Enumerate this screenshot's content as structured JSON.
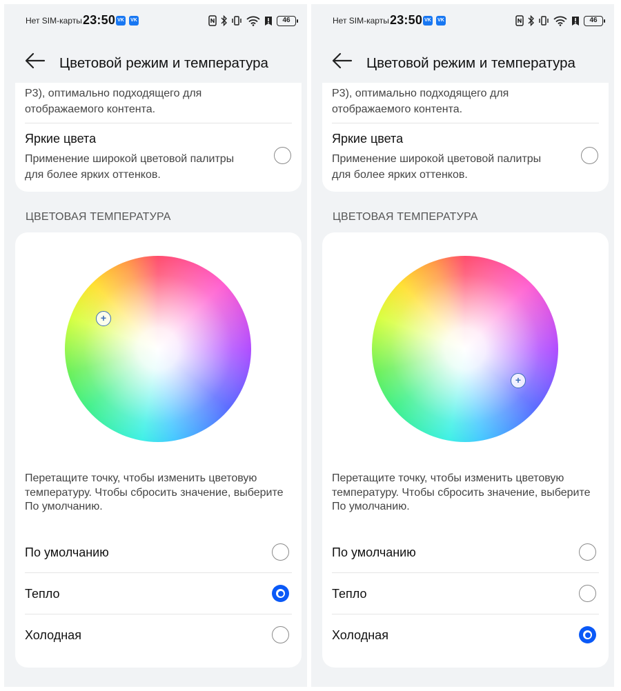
{
  "screens": [
    {
      "status": {
        "carrier": "Нет SIM-карты",
        "time": "23:50",
        "vk": "VK",
        "battery": "46"
      },
      "title": "Цветовой режим и температура",
      "top_card": {
        "partial_text": "P3), оптимально подходящего для отображаемого контента.",
        "vivid_title": "Яркие цвета",
        "vivid_desc": "Применение широкой цветовой палитры для более ярких оттенков."
      },
      "section_title": "ЦВЕТОВАЯ ТЕМПЕРАТУРА",
      "picker_symbol": "+",
      "hint": "Перетащите точку, чтобы изменить цветовую температуру. Чтобы сбросить значение, выберите По умолчанию.",
      "options": [
        {
          "label": "По умолчанию",
          "selected": false
        },
        {
          "label": "Тепло",
          "selected": true
        },
        {
          "label": "Холодная",
          "selected": false
        }
      ]
    },
    {
      "status": {
        "carrier": "Нет SIM-карты",
        "time": "23:50",
        "vk": "VK",
        "battery": "46"
      },
      "title": "Цветовой режим и температура",
      "top_card": {
        "partial_text": "P3), оптимально подходящего для отображаемого контента.",
        "vivid_title": "Яркие цвета",
        "vivid_desc": "Применение широкой цветовой палитры для более ярких оттенков."
      },
      "section_title": "ЦВЕТОВАЯ ТЕМПЕРАТУРА",
      "picker_symbol": "+",
      "hint": "Перетащите точку, чтобы изменить цветовую температуру. Чтобы сбросить значение, выберите По умолчанию.",
      "options": [
        {
          "label": "По умолчанию",
          "selected": false
        },
        {
          "label": "Тепло",
          "selected": false
        },
        {
          "label": "Холодная",
          "selected": true
        }
      ]
    }
  ],
  "colors": {
    "accent": "#0a59f7",
    "background": "#f1f3f5",
    "card": "#ffffff"
  },
  "icons": [
    "back-arrow-icon",
    "vk-icon",
    "nfc-icon",
    "bluetooth-icon",
    "vibrate-icon",
    "wifi-icon",
    "notification-icon",
    "battery-icon"
  ]
}
